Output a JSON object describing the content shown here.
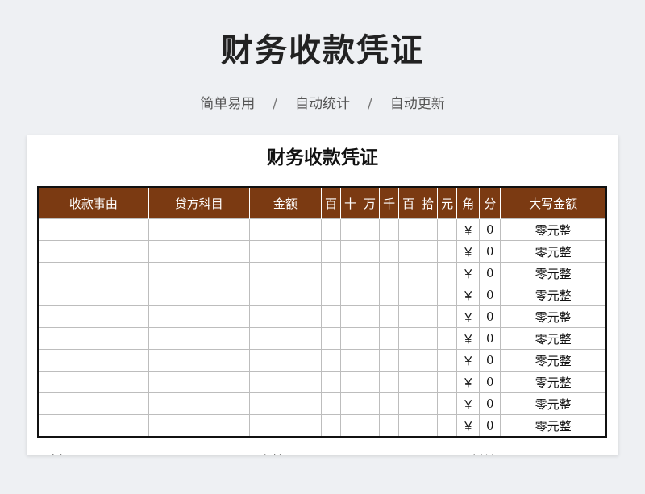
{
  "page": {
    "title": "财务收款凭证",
    "subtitle": [
      "简单易用",
      "自动统计",
      "自动更新"
    ],
    "separator": "/"
  },
  "sheet": {
    "title": "财务收款凭证",
    "headers": [
      "收款事由",
      "贷方科目",
      "金额",
      "百",
      "十",
      "万",
      "千",
      "百",
      "拾",
      "元",
      "角",
      "分",
      "大写金额"
    ],
    "rows": [
      [
        "",
        "",
        "",
        "",
        "",
        "",
        "",
        "",
        "",
        "",
        "￥",
        "0",
        "零元整"
      ],
      [
        "",
        "",
        "",
        "",
        "",
        "",
        "",
        "",
        "",
        "",
        "￥",
        "0",
        "零元整"
      ],
      [
        "",
        "",
        "",
        "",
        "",
        "",
        "",
        "",
        "",
        "",
        "￥",
        "0",
        "零元整"
      ],
      [
        "",
        "",
        "",
        "",
        "",
        "",
        "",
        "",
        "",
        "",
        "￥",
        "0",
        "零元整"
      ],
      [
        "",
        "",
        "",
        "",
        "",
        "",
        "",
        "",
        "",
        "",
        "￥",
        "0",
        "零元整"
      ],
      [
        "",
        "",
        "",
        "",
        "",
        "",
        "",
        "",
        "",
        "",
        "￥",
        "0",
        "零元整"
      ],
      [
        "",
        "",
        "",
        "",
        "",
        "",
        "",
        "",
        "",
        "",
        "￥",
        "0",
        "零元整"
      ],
      [
        "",
        "",
        "",
        "",
        "",
        "",
        "",
        "",
        "",
        "",
        "￥",
        "0",
        "零元整"
      ],
      [
        "",
        "",
        "",
        "",
        "",
        "",
        "",
        "",
        "",
        "",
        "￥",
        "0",
        "零元整"
      ],
      [
        "",
        "",
        "",
        "",
        "",
        "",
        "",
        "",
        "",
        "",
        "￥",
        "0",
        "零元整"
      ]
    ],
    "footer": [
      "财务",
      "审核",
      "制单"
    ]
  },
  "colors": {
    "header_bg": "#7b3a12",
    "page_bg": "#eef0f3"
  }
}
